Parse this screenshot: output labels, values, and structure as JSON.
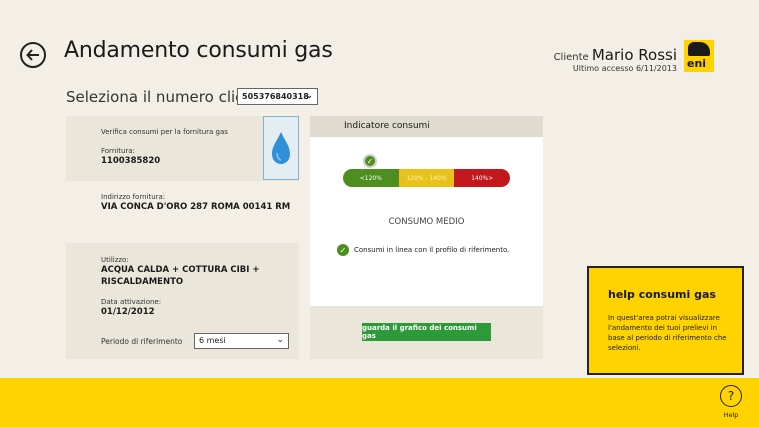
{
  "header": {
    "title": "Andamento consumi gas",
    "customer_prefix": "Cliente",
    "customer_name": "Mario Rossi",
    "last_access": "Ultimo accesso 6/11/2013",
    "logo_text": "eni"
  },
  "client_select": {
    "label": "Seleziona il numero cliente",
    "value": "505376840318"
  },
  "supply": {
    "intro": "Verifica consumi per la fornitura gas",
    "fornitura_label": "Fornitura:",
    "fornitura_value": "1100385820",
    "indirizzo_label": "Indirizzo fornitura:",
    "indirizzo_value": "VIA CONCA D'ORO 287 ROMA 00141 RM",
    "utilizzo_label": "Utilizzo:",
    "utilizzo_value_line1": "ACQUA CALDA + COTTURA CIBI +",
    "utilizzo_value_line2": "RISCALDAMENTO",
    "attivazione_label": "Data attivazione:",
    "attivazione_value": "01/12/2012",
    "periodo_label": "Periodo di riferimento",
    "periodo_value": "6 mesi"
  },
  "indicator": {
    "title": "Indicatore consumi",
    "segments": [
      "<120%",
      "120% - 140%",
      "140%>"
    ],
    "level_label": "CONSUMO MEDIO",
    "status_text": "Consumi in linea con il profilo di riferimento.",
    "graph_button": "guarda il grafico dei consumi gas"
  },
  "help": {
    "title": "help consumi gas",
    "text": "In quest'area potrai visualizzare l'andamento dei tuoi prelievi in base al periodo di riferimento che selezioni.",
    "button_label": "Help"
  },
  "colors": {
    "brand_yellow": "#ffd200",
    "green": "#4e8e1f",
    "yellow": "#e8c21a",
    "red": "#c1171d",
    "button_green": "#2c9a39"
  }
}
